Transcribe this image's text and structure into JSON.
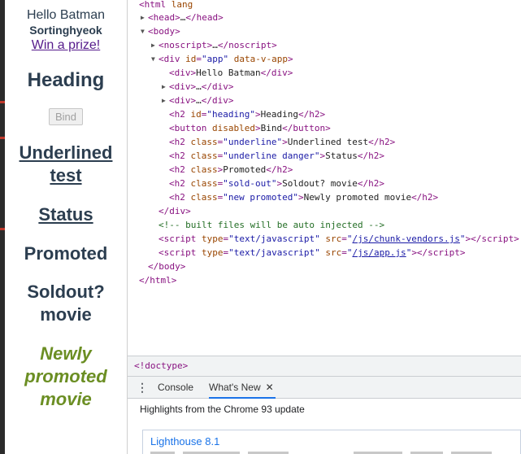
{
  "page": {
    "hello": "Hello Batman",
    "username": "Sortinghyeok",
    "prize_link": "Win a prize!",
    "heading": "Heading",
    "bind_button": "Bind",
    "underlined_line1": "Underlined",
    "underlined_line2": "test",
    "status": "Status",
    "promoted": "Promoted",
    "soldout_line1": "Soldout?",
    "soldout_line2": "movie",
    "new_line1": "Newly",
    "new_line2": "promoted",
    "new_line3": "movie"
  },
  "tree": {
    "html_open": "html",
    "html_attr": "lang",
    "head": "head",
    "body_open": "body",
    "noscript": "noscript",
    "div_app_id": "app",
    "div_app_vattr": "data-v-app",
    "hello_text": "Hello Batman",
    "h2_heading_id": "heading",
    "h2_heading_text": "Heading",
    "button_attr": "disabled",
    "button_text": "Bind",
    "underline_class": "underline",
    "underline_text": "Underlined test",
    "underline_danger_class": "underline danger",
    "status_text": "Status",
    "promoted_text": "Promoted",
    "soldout_class": "sold-out",
    "soldout_text": "Soldout? movie",
    "new_promoted_class": "new promoted",
    "new_promoted_text": "Newly promoted movie",
    "comment": "<!-- built files will be auto injected -->",
    "script1_src": "/js/chunk-vendors.js",
    "script2_src": "/js/app.js",
    "script_type": "text/javascript"
  },
  "breadcrumb": "<!doctype>",
  "drawer": {
    "tab_console": "Console",
    "tab_whatsnew": "What's New",
    "highlights": "Highlights from the Chrome 93 update",
    "card_title": "Lighthouse 8.1"
  },
  "colors": {
    "tag": "#881280",
    "attr_name": "#994500",
    "attr_value": "#1a1aa6",
    "comment": "#236e25",
    "promoted_green": "#6b8e23",
    "accent": "#1a73e8"
  }
}
